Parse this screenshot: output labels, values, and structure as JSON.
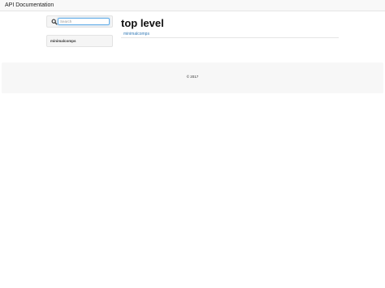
{
  "navbar": {
    "brand": "API Documentation"
  },
  "search": {
    "placeholder": "Search",
    "value": ""
  },
  "sidebar": {
    "items": [
      {
        "label": "minimalcomps"
      }
    ]
  },
  "main": {
    "title": "top level",
    "links": [
      {
        "label": "minimalcomps"
      }
    ]
  },
  "footer": {
    "copyright": "© 2017"
  },
  "colors": {
    "link": "#337ab7",
    "focus_border": "#66afe9",
    "navbar_bg": "#f8f8f8",
    "footer_bg": "#f7f7f7"
  },
  "icons": {
    "search": "search-icon"
  }
}
